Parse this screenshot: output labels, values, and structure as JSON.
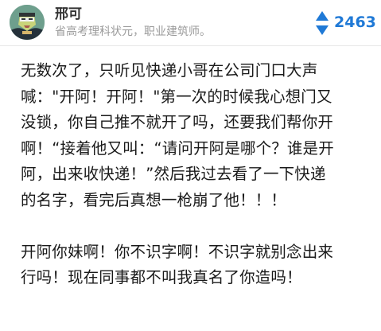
{
  "author": {
    "name": "邢可",
    "bio": "省高考理科状元，职业建筑师。",
    "avatar_icon": "avatar-illustration"
  },
  "vote": {
    "icon": "upvote-icon",
    "count": "2463",
    "color": "#1f79d6"
  },
  "content": {
    "paragraph1": [
      "无数次了，只听见快递小哥在公司门口大声",
      "喊：\"开阿！开阿！\"第一次的时候我心想门又",
      "没锁，你自己推不就开了吗，还要我们帮你开",
      "啊！“接着他又叫：“请问开阿是哪个？谁是开",
      "阿，出来收快递！”然后我过去看了一下快递",
      "的名字，看完后真想一枪崩了他！！！"
    ],
    "paragraph2": [
      "开阿你妹啊！你不识字啊！不识字就别念出来",
      "行吗！现在同事都不叫我真名了你造吗！"
    ]
  }
}
